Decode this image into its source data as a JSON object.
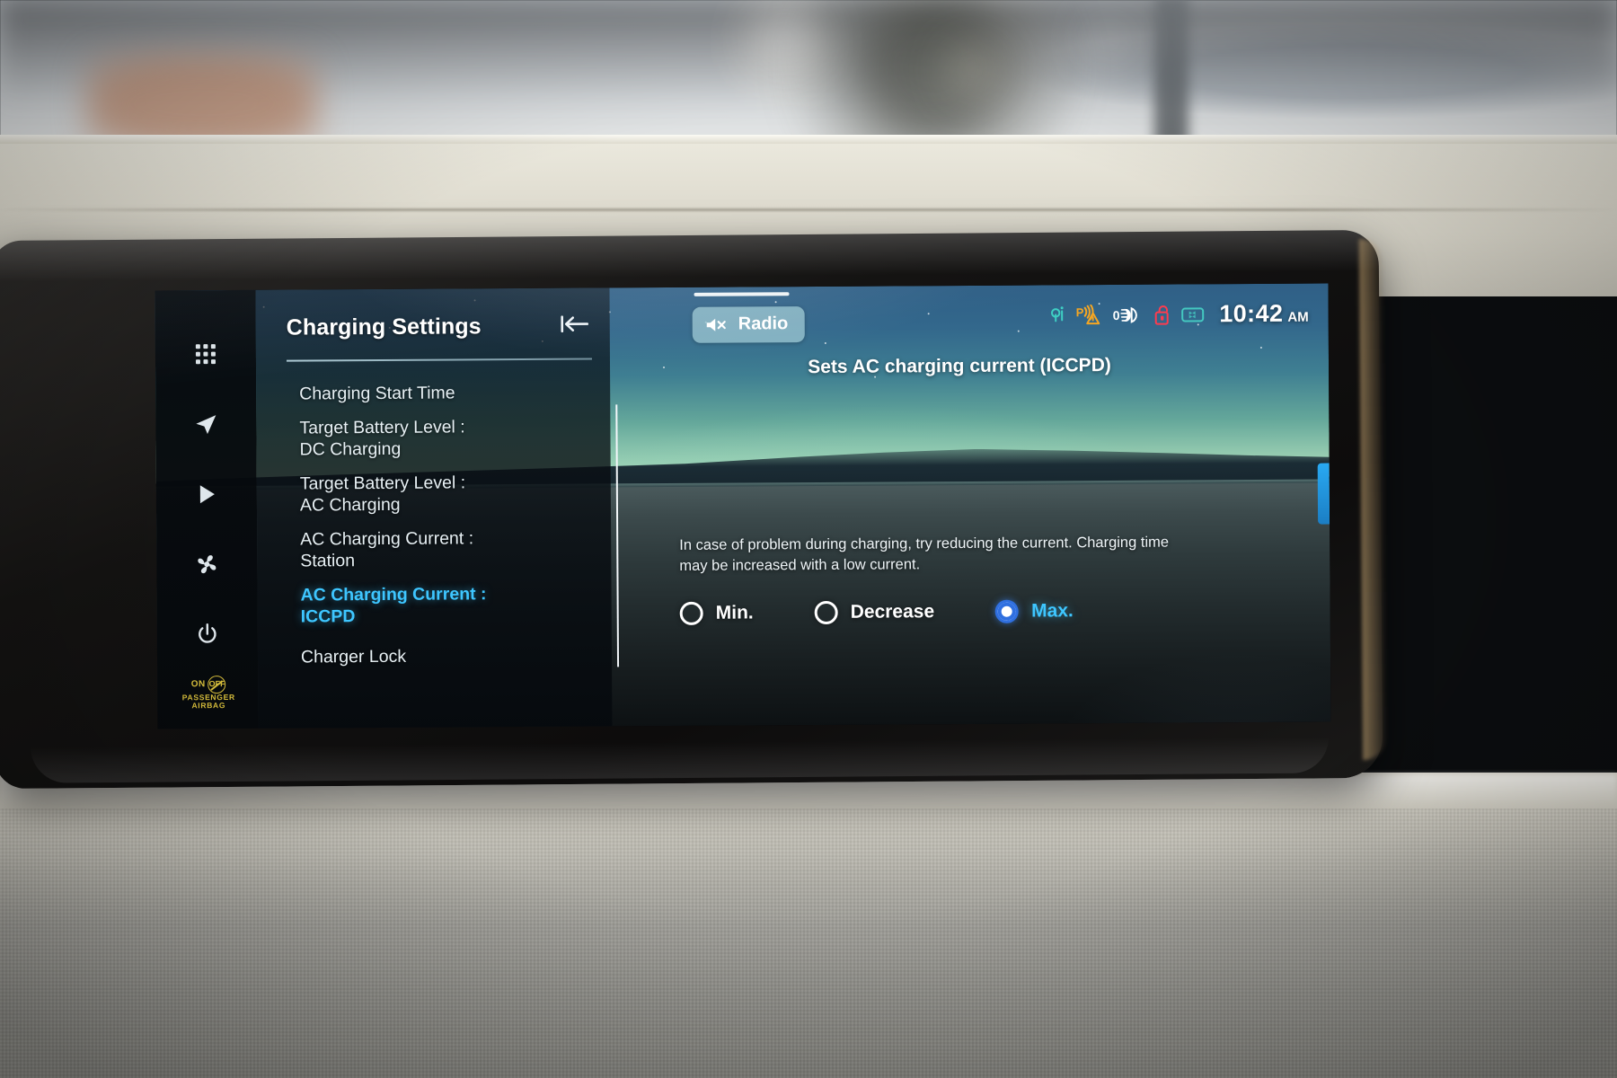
{
  "rail": {
    "items": [
      {
        "name": "apps-grid-icon",
        "label": "Apps"
      },
      {
        "name": "navigation-icon",
        "label": "Navigation"
      },
      {
        "name": "media-play-icon",
        "label": "Media"
      },
      {
        "name": "climate-fan-icon",
        "label": "Climate"
      },
      {
        "name": "power-icon",
        "label": "Power"
      }
    ],
    "airbag": {
      "on": "ON",
      "off": "OFF",
      "line1": "PASSENGER",
      "line2": "AIRBAG"
    }
  },
  "menu": {
    "title": "Charging Settings",
    "back_icon": "back-arrow-icon",
    "items": [
      {
        "line1": "Charging Start Time",
        "line2": "",
        "selected": false
      },
      {
        "line1": "Target Battery Level :",
        "line2": "DC Charging",
        "selected": false
      },
      {
        "line1": "Target Battery Level :",
        "line2": "AC Charging",
        "selected": false
      },
      {
        "line1": "AC Charging Current :",
        "line2": "Station",
        "selected": false
      },
      {
        "line1": "AC Charging Current :",
        "line2": "ICCPD",
        "selected": true
      },
      {
        "line1": "Charger Lock",
        "line2": "",
        "selected": false
      }
    ]
  },
  "content": {
    "radio_chip": {
      "label": "Radio",
      "icon": "speaker-mute-icon"
    },
    "description_heading": "Sets AC charging current (ICCPD)",
    "paragraph": "In case of problem during charging, try reducing the current. Charging time may be increased with a low current.",
    "options": [
      {
        "label": "Min.",
        "selected": false
      },
      {
        "label": "Decrease",
        "selected": false
      },
      {
        "label": "Max.",
        "selected": true
      }
    ]
  },
  "status_bar": {
    "icons": [
      {
        "name": "qi-wireless-charging-icon",
        "color": "#3ecfc4"
      },
      {
        "name": "parking-sensor-warning-icon",
        "color": "#f5a623"
      },
      {
        "name": "headlight-icon",
        "color": "#eaf2ff"
      },
      {
        "name": "door-unlocked-icon",
        "color": "#ff3b4e"
      },
      {
        "name": "bluetooth-device-icon",
        "color": "#44c8c0"
      }
    ],
    "time": "10:42",
    "ampm": "AM"
  },
  "colors": {
    "accent_cyan": "#3ec6ff",
    "radio_selected_blue": "#2f6fe0",
    "menu_text": "#e8f1f5",
    "chip_bg": "rgba(152,196,208,0.78)"
  }
}
